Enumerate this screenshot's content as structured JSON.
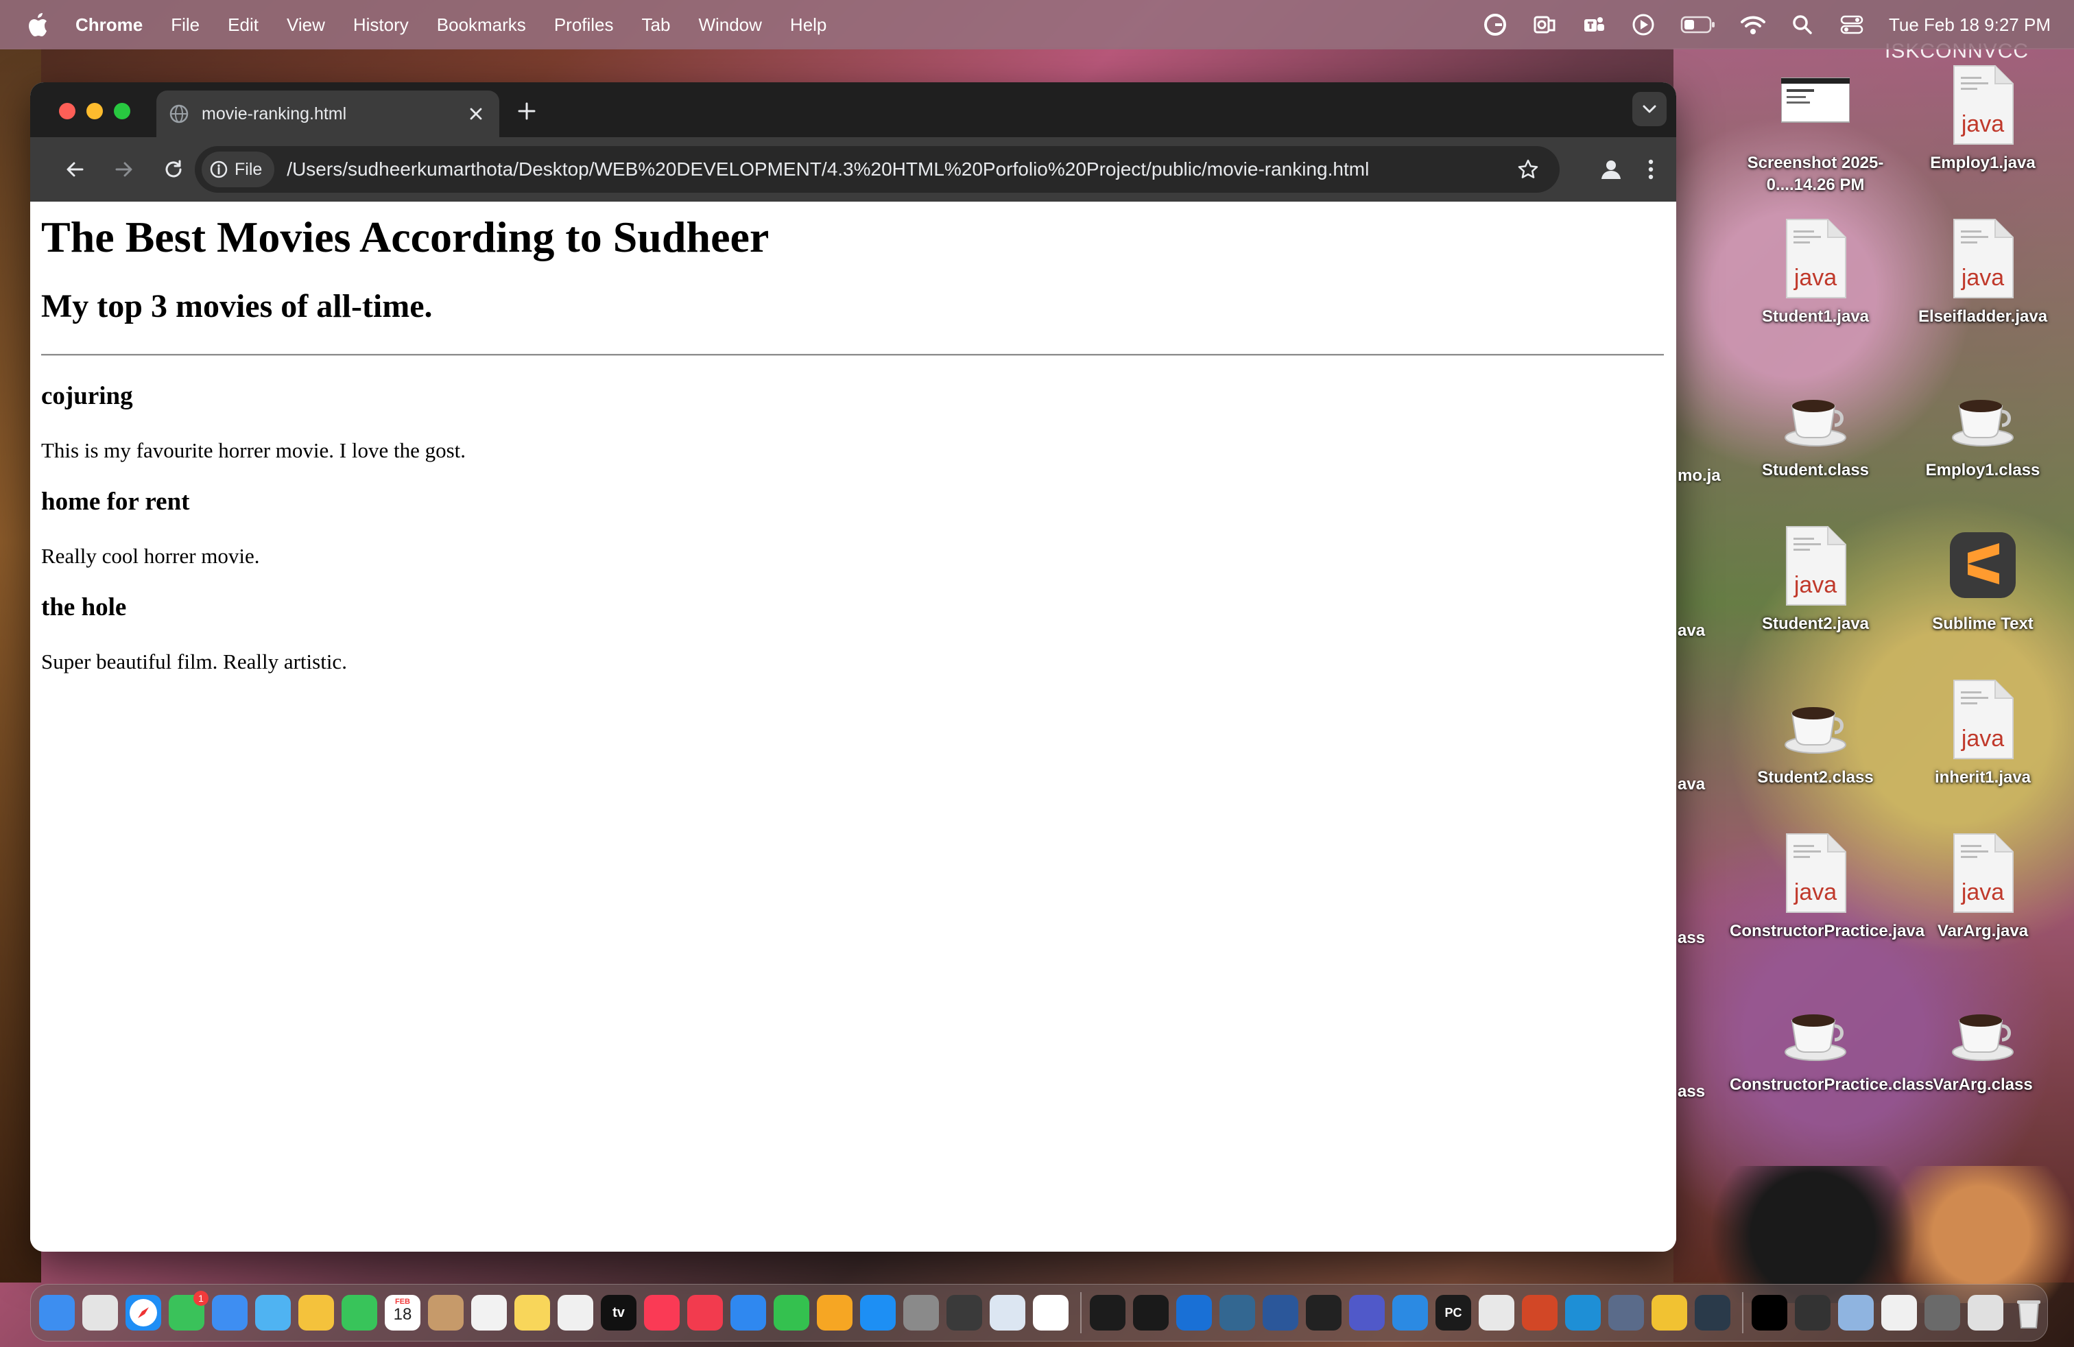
{
  "menubar": {
    "app_name": "Chrome",
    "menus": [
      "File",
      "Edit",
      "View",
      "History",
      "Bookmarks",
      "Profiles",
      "Tab",
      "Window",
      "Help"
    ],
    "clock": "Tue Feb 18  9:27 PM",
    "status_icons": [
      "grammarly-icon",
      "outlook-icon",
      "teams-icon",
      "play-icon",
      "battery-icon",
      "wifi-icon",
      "spotlight-icon",
      "control-center-icon"
    ]
  },
  "browser": {
    "tab_title": "movie-ranking.html",
    "site_chip_label": "File",
    "url": "/Users/sudheerkumarthota/Desktop/WEB%20DEVELOPMENT/4.3%20HTML%20Porfolio%20Project/public/movie-ranking.html"
  },
  "page": {
    "h1": "The Best Movies According to Sudheer",
    "h2": "My top 3 movies of all-time.",
    "movies": [
      {
        "title": "cojuring",
        "description": "This is my favourite horrer movie. I love the gost."
      },
      {
        "title": "home for rent",
        "description": "Really cool horrer movie."
      },
      {
        "title": "the hole",
        "description": "Super beautiful film. Really artistic."
      }
    ]
  },
  "desktop": {
    "watermark": "ISKCONNVCC",
    "icons": [
      {
        "label": "Screenshot 2025-0....14.26 PM",
        "kind": "screenshot"
      },
      {
        "label": "Employ1.java",
        "kind": "java"
      },
      {
        "label": "Student1.java",
        "kind": "java"
      },
      {
        "label": "Elseifladder.java",
        "kind": "java"
      },
      {
        "label": "Student.class",
        "kind": "class"
      },
      {
        "label": "Employ1.class",
        "kind": "class"
      },
      {
        "label": "Student2.java",
        "kind": "java"
      },
      {
        "label": "Sublime Text",
        "kind": "sublime"
      },
      {
        "label": "Student2.class",
        "kind": "class"
      },
      {
        "label": "inherit1.java",
        "kind": "java"
      },
      {
        "label": "ConstructorPractice.java",
        "kind": "java"
      },
      {
        "label": "VarArg.java",
        "kind": "java"
      },
      {
        "label": "ConstructorPractice.class",
        "kind": "class"
      },
      {
        "label": "VarArg.class",
        "kind": "class"
      }
    ],
    "partial_labels": [
      "mo.ja",
      "ava",
      "ava",
      "ass",
      "ass"
    ],
    "java_badge": "java"
  },
  "dock": {
    "apps": [
      "finder",
      "launchpad",
      "safari",
      "messages",
      "mail",
      "maps",
      "photos",
      "facetime",
      "calendar",
      "contacts",
      "reminders",
      "notes",
      "freeform",
      "tv",
      "music",
      "news",
      "keynote",
      "numbers",
      "pages",
      "app-store",
      "system-settings",
      "sublime-text",
      "preview",
      "chrome",
      "terminal",
      "activity-monitor",
      "outlook",
      "postgres",
      "word",
      "piano",
      "teams",
      "vscode",
      "pycharm",
      "textedit",
      "powerpoint",
      "vscode-insiders",
      "screen-sharing",
      "chrome-canary",
      "window-1",
      "window-2",
      "window-3",
      "window-4",
      "window-5",
      "window-6",
      "window-7",
      "trash"
    ],
    "calendar_month": "FEB",
    "calendar_day": "18",
    "messages_badge": "1",
    "tv_label": "tv",
    "pycharm_label": "PC"
  },
  "colors": {
    "menubar_bg": "#966e7d",
    "tab_strip": "#1f1f1f",
    "toolbar": "#3c3c3c",
    "omnibox": "#282828",
    "traffic_red": "#fe5f57",
    "traffic_yellow": "#febc2e",
    "traffic_green": "#28c840",
    "java_text": "#c0392b"
  }
}
